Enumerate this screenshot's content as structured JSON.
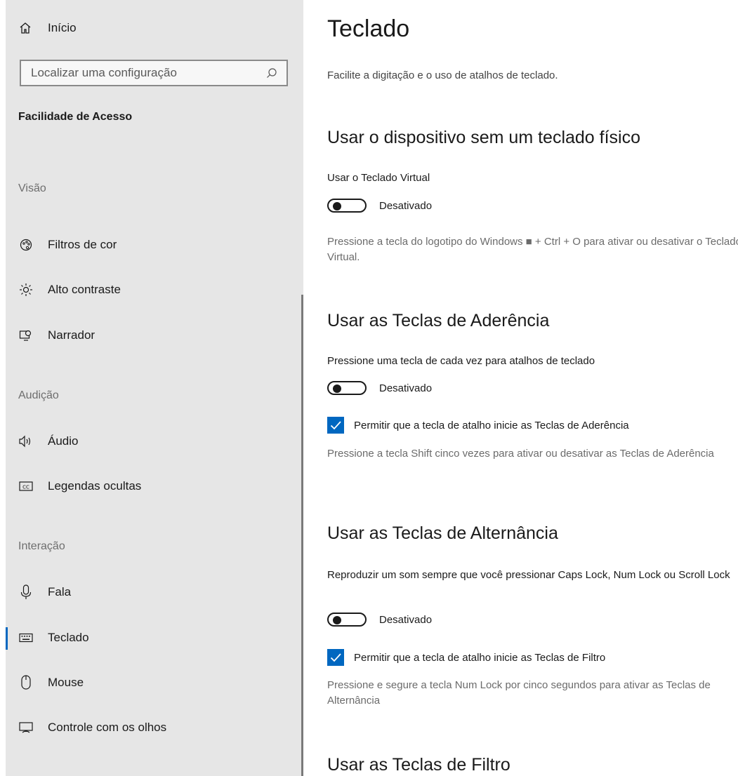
{
  "sidebar": {
    "home_label": "Início",
    "search_placeholder": "Localizar uma configuração",
    "section_title": "Facilidade de Acesso",
    "groups": {
      "vision": "Visão",
      "hearing": "Audição",
      "interaction": "Interação"
    },
    "items": [
      {
        "label": "Filtros de cor",
        "icon": "color-filter-icon"
      },
      {
        "label": "Alto contraste",
        "icon": "high-contrast-icon"
      },
      {
        "label": "Narrador",
        "icon": "narrator-icon"
      },
      {
        "label": "Áudio",
        "icon": "audio-icon"
      },
      {
        "label": "Legendas ocultas",
        "icon": "closed-captions-icon"
      },
      {
        "label": "Fala",
        "icon": "microphone-icon"
      },
      {
        "label": "Teclado",
        "icon": "keyboard-icon",
        "selected": true
      },
      {
        "label": "Mouse",
        "icon": "mouse-icon"
      },
      {
        "label": "Controle com os olhos",
        "icon": "eye-control-icon"
      }
    ]
  },
  "main": {
    "title": "Teclado",
    "subtitle": "Facilite a digitação e o uso de atalhos de teclado.",
    "virtual_keyboard": {
      "heading": "Usar o dispositivo sem um teclado físico",
      "toggle_label": "Usar o Teclado Virtual",
      "toggle_state": "Desativado",
      "description": "Pressione a tecla do logotipo do Windows ■ + Ctrl + O para ativar ou desativar o Teclado Virtual."
    },
    "sticky_keys": {
      "heading": "Usar as Teclas de Aderência",
      "toggle_label": "Pressione uma tecla de cada vez para atalhos de teclado",
      "toggle_state": "Desativado",
      "checkbox_label": "Permitir que a tecla de atalho inicie as Teclas de Aderência",
      "checkbox_checked": true,
      "description": "Pressione a tecla Shift cinco vezes para ativar ou desativar as Teclas de Aderência"
    },
    "toggle_keys": {
      "heading": "Usar as Teclas de Alternância",
      "toggle_label": "Reproduzir um som sempre que você pressionar Caps Lock, Num Lock ou Scroll Lock",
      "toggle_state": "Desativado",
      "checkbox_label": "Permitir que a tecla de atalho inicie as Teclas de Filtro",
      "checkbox_checked": true,
      "description": "Pressione e segure a tecla Num Lock por cinco segundos para ativar as Teclas de Alternância"
    },
    "filter_keys": {
      "heading": "Usar as Teclas de Filtro"
    }
  },
  "colors": {
    "accent": "#0067c0",
    "sidebar_bg": "#e6e6e6",
    "text": "#1a1a1a",
    "muted": "#6b6b6b"
  }
}
